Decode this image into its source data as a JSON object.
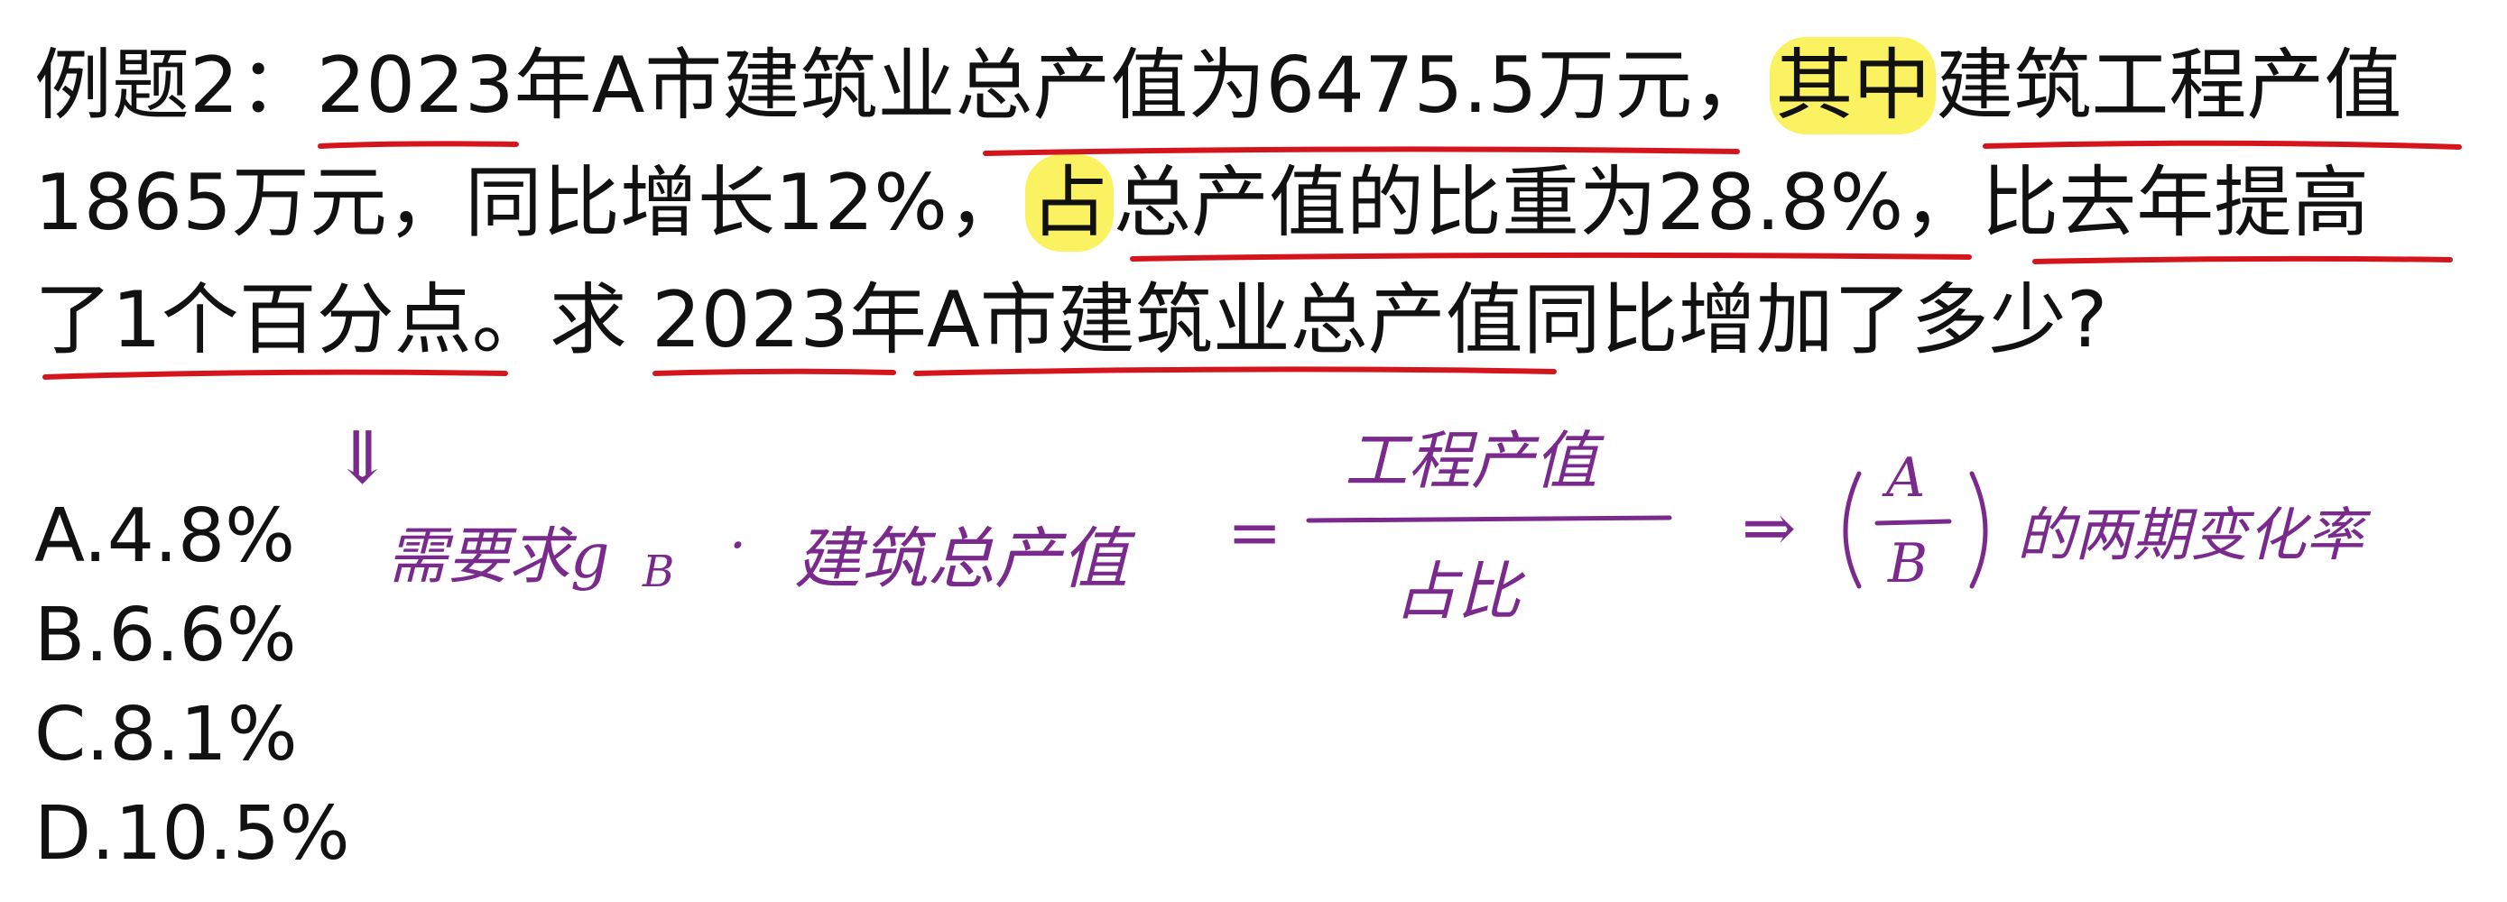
{
  "question": {
    "line1": {
      "prefix": "例题2：",
      "p1": "2023年",
      "p2": "A市建筑业",
      "p3": "总产值为6475.5万元",
      "p4": "，",
      "p5": "其中",
      "p6": "建筑工程产值"
    },
    "line2": {
      "p1": "1865万元，同比增长12%，",
      "p2": "占",
      "p3": "总产值的比重为28.8%",
      "p4": "，",
      "p5": "比去年提高"
    },
    "line3": {
      "p1": "了1个百分点",
      "p2": "。求 ",
      "p3": "2023年",
      "p4": "A市建筑业总产值",
      "p5": "同比增加了多少?"
    }
  },
  "options": [
    "A.4.8%",
    "B.6.6%",
    "C.8.1%",
    "D.10.5%"
  ],
  "annotations": {
    "arrow": "⇓",
    "need": "需要求g",
    "need_sub": "B",
    "dot": "·",
    "term": "建筑总产值",
    "equals": "=",
    "numerator": "工程产值",
    "denominator": "占比",
    "implies": "⇒",
    "frac_a": "A",
    "frac_b": "B",
    "suffix": "的两期变化率"
  },
  "colors": {
    "underline": "#d4161c",
    "highlight": "#f7ee3a",
    "handwriting": "#7a2a8c",
    "text": "#111111"
  }
}
